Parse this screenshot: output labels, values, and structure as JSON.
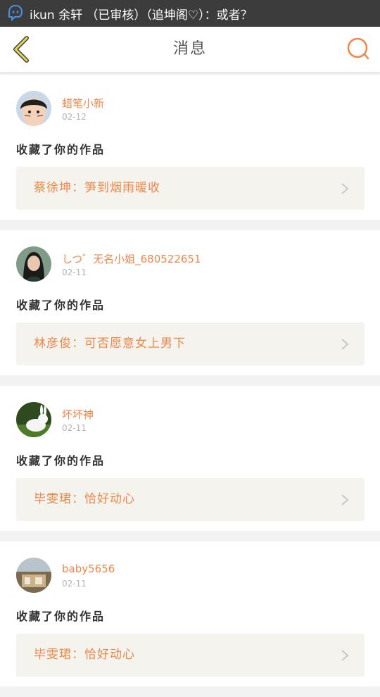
{
  "status_bar": {
    "notification_text": "ikun 余轩  （已审核）（追坤阁♡）：或者？"
  },
  "header": {
    "title": "消息"
  },
  "messages": [
    {
      "user": "蜡笔小新",
      "time": "02-12",
      "action": "收藏了你的作品",
      "work": "蔡徐坤：笋到烟雨暖收"
    },
    {
      "user": "しつ゛无名小姐_680522651",
      "time": "02-11",
      "action": "收藏了你的作品",
      "work": "林彦俊：可否愿意女上男下"
    },
    {
      "user": "坏坏神",
      "time": "02-11",
      "action": "收藏了你的作品",
      "work": "毕雯珺：恰好动心"
    },
    {
      "user": "baby5656",
      "time": "02-11",
      "action": "收藏了你的作品",
      "work": "毕雯珺：恰好动心"
    }
  ],
  "colors": {
    "accent": "#f0874a",
    "back_icon": "#e5d65a",
    "status_bar": "#3c3c3c",
    "work_bg": "#f4f3ee"
  },
  "icons": {
    "back": "chevron-left-icon",
    "search": "search-icon",
    "arrow": "chevron-right-icon",
    "notification": "chat-bubble-icon"
  }
}
